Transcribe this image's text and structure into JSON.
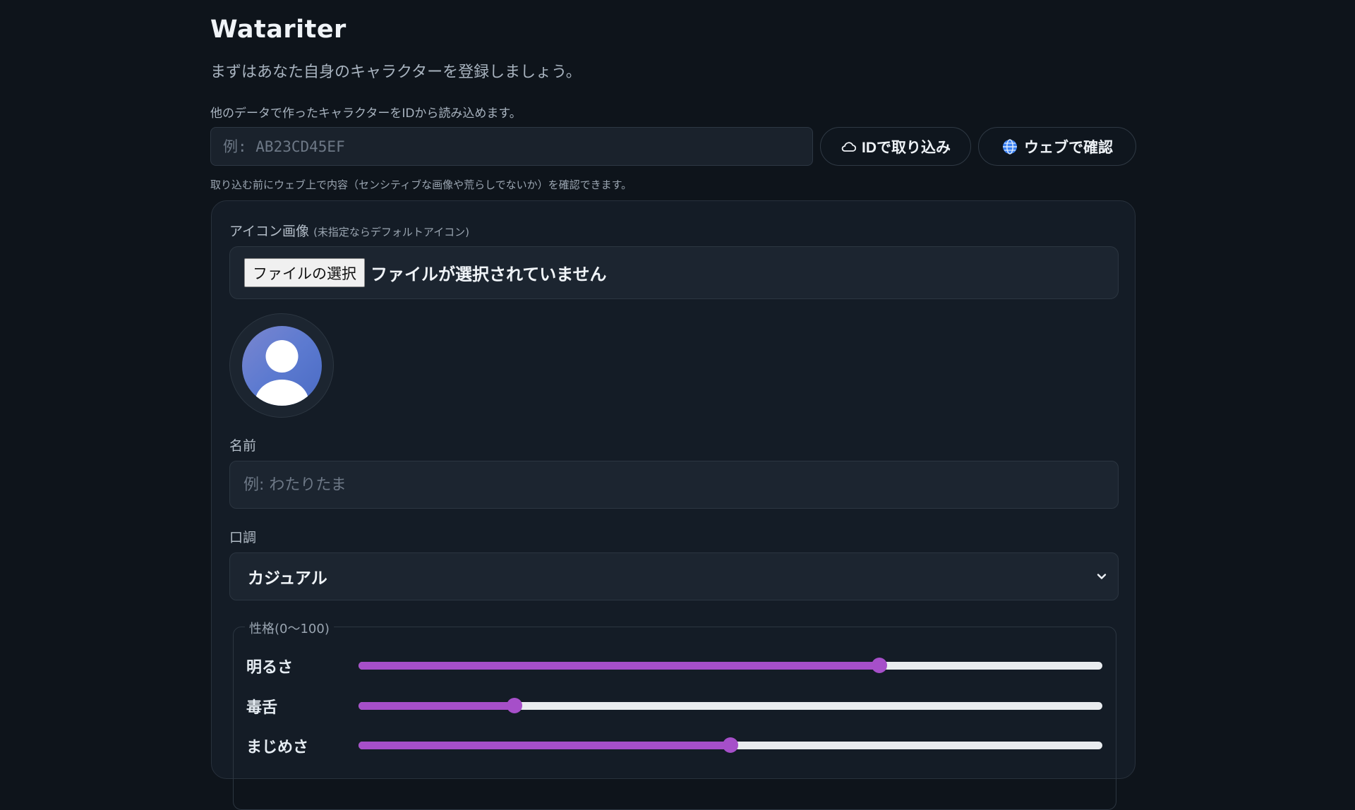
{
  "app": {
    "title": "Watariter",
    "subtitle": "まずはあなた自身のキャラクターを登録しましょう。"
  },
  "import": {
    "hint": "他のデータで作ったキャラクターをIDから読み込めます。",
    "id_placeholder": "例: AB23CD45EF",
    "import_button": "IDで取り込み",
    "web_button": "ウェブで確認",
    "note": "取り込む前にウェブ上で内容（センシティブな画像や荒らしでないか）を確認できます。"
  },
  "form": {
    "icon_label": "アイコン画像",
    "icon_hint": "(未指定ならデフォルトアイコン)",
    "file_button": "ファイルの選択",
    "file_status": "ファイルが選択されていません",
    "name_label": "名前",
    "name_placeholder": "例: わたりたま",
    "tone_label": "口調",
    "tone_value": "カジュアル",
    "personality_legend": "性格(0〜100)",
    "traits": [
      {
        "label": "明るさ",
        "value": 70
      },
      {
        "label": "毒舌",
        "value": 21
      },
      {
        "label": "まじめさ",
        "value": 50
      }
    ]
  },
  "colors": {
    "background": "#0e141b",
    "accent": "#a64fc9",
    "card": "#141c26"
  },
  "icons": {
    "import": "cloud-icon",
    "web": "globe-icon",
    "avatar": "default-user-avatar",
    "select": "chevron-down-icon"
  }
}
